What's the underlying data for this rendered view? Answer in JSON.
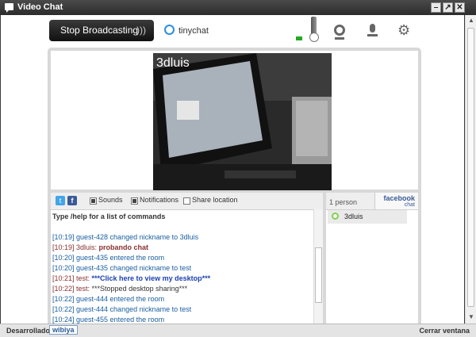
{
  "window": {
    "title": "Video Chat"
  },
  "toolbar": {
    "stop_label": "Stop Broadcasting",
    "brand": "tinychat",
    "volume_level": 0.3
  },
  "video": {
    "username": "3dluis"
  },
  "chat": {
    "sounds_label": "Sounds",
    "sounds_checked": true,
    "notifications_label": "Notifications",
    "notifications_checked": true,
    "share_location_label": "Share location",
    "share_location_checked": false,
    "messages": [
      {
        "text": "Type /help for a list of commands",
        "color": "#333333",
        "bold": true
      },
      {
        "text": "",
        "color": "#333333",
        "bold": false
      },
      {
        "text": "[10:19] guest-428 changed nickname to 3dluis",
        "color": "#1a5fa0",
        "bold": false
      },
      {
        "prefix": "[10:19] 3dluis: ",
        "text": "probando chat",
        "color": "#8a3030",
        "bold": true
      },
      {
        "text": "[10:20] guest-435 entered the room",
        "color": "#1a5fa0",
        "bold": false
      },
      {
        "text": "[10:20] guest-435 changed nickname to test",
        "color": "#1a5fa0",
        "bold": false
      },
      {
        "prefix": "[10:21] test: ",
        "text": "***Click here to view my desktop***",
        "color": "#1a3fb0",
        "bold": true,
        "prefix_color": "#8a3030"
      },
      {
        "prefix": "[10:22] test: ",
        "text": "***Stopped desktop sharing***",
        "color": "#333333",
        "bold": false,
        "prefix_color": "#8a3030"
      },
      {
        "text": "[10:22] guest-444 entered the room",
        "color": "#1a5fa0",
        "bold": false
      },
      {
        "text": "[10:22] guest-444 changed nickname to test",
        "color": "#1a5fa0",
        "bold": false
      },
      {
        "text": "[10:24] guest-455 entered the room",
        "color": "#1a5fa0",
        "bold": false
      }
    ]
  },
  "users": {
    "count_label": "1 person",
    "facebook_label": "facebook",
    "facebook_sub": "chat",
    "list": [
      {
        "name": "3dluis"
      }
    ]
  },
  "footer": {
    "left_label": "Desarrollado por",
    "logo_text": "wibiya",
    "right_label": "Cerrar ventana"
  },
  "icons": {
    "window": "chat-bubble-icon",
    "minimize": "minimize-icon",
    "maximize": "maximize-icon",
    "close": "close-icon",
    "broadcast": "broadcast-waves-icon",
    "brand": "tinychat-logo-icon",
    "camera": "webcam-icon",
    "mic": "microphone-icon",
    "settings": "gear-icon",
    "twitter": "twitter-icon",
    "facebook": "facebook-icon",
    "user_status": "user-online-icon"
  },
  "colors": {
    "accent_green": "#22aa22",
    "link_blue": "#1a5fa0",
    "facebook_blue": "#3b5998"
  }
}
